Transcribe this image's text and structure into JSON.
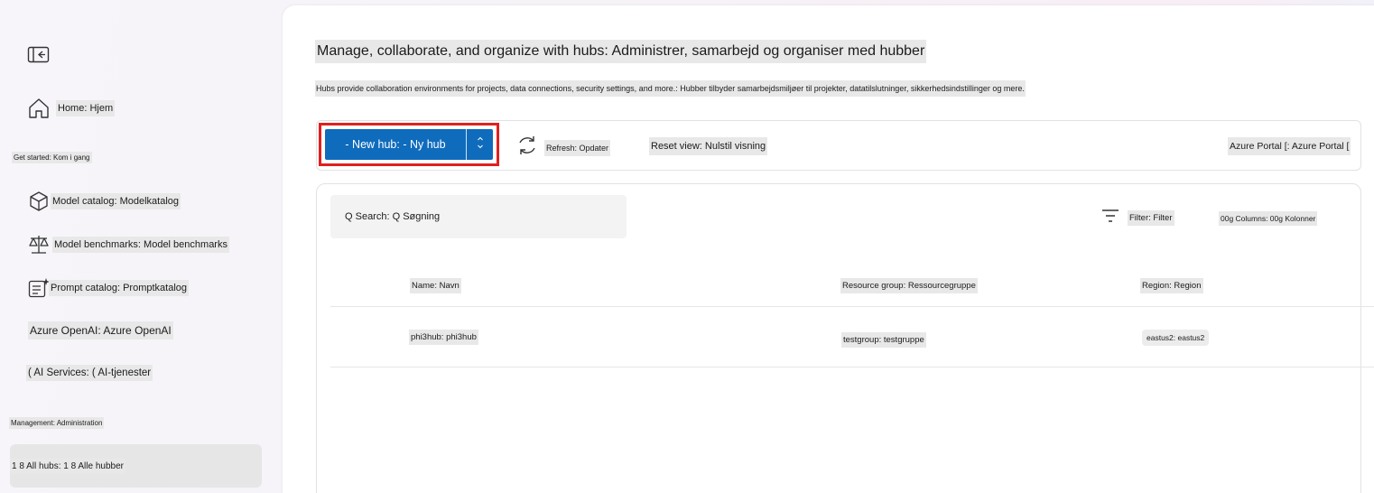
{
  "sidebar": {
    "collapse_icon": "collapse-panel-icon",
    "home": "Home: Hjem",
    "get_started": "Get started: Kom i gang",
    "model_catalog": "Model catalog: Modelkatalog",
    "model_benchmarks": "Model benchmarks: Model benchmarks",
    "prompt_catalog": "Prompt catalog: Promptkatalog",
    "azure_openai": "Azure OpenAI: Azure OpenAI",
    "ai_services": "( AI Services: ( AI-tjenester",
    "management": "Management: Administration",
    "all_hubs": "1 8 All hubs: 1 8 Alle hubber"
  },
  "main": {
    "title": "Manage, collaborate, and organize with hubs: Administrer, samarbejd og organiser med hubber",
    "subtitle": "Hubs provide collaboration environments for projects, data connections, security settings, and more.: Hubber tilbyder samarbejdsmiljøer til projekter, datatilslutninger, sikkerhedsindstillinger og mere."
  },
  "toolbar": {
    "new_hub": "- New hub: - Ny hub",
    "refresh": "Refresh: Opdater",
    "reset_view": "Reset view: Nulstil visning",
    "azure_portal": "Azure Portal [: Azure Portal ["
  },
  "grid": {
    "search": "Q Search: Q Søgning",
    "filter": "Filter: Filter",
    "columns": "00g Columns: 00g Kolonner",
    "headers": {
      "name": "Name: Navn",
      "resource_group": "Resource group: Ressourcegruppe",
      "region": "Region: Region"
    },
    "rows": [
      {
        "name": "phi3hub: phi3hub",
        "resource_group": "testgroup: testgruppe",
        "region": "eastus2: eastus2"
      }
    ]
  },
  "colors": {
    "accent": "#0f6cbd",
    "highlight_border": "#e0201f"
  }
}
